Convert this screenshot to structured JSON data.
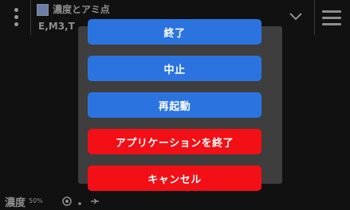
{
  "app": {
    "title": "濃度とアミ点",
    "subtitle": "E,M3,T"
  },
  "status_bar": {
    "label": "濃度",
    "percent": "50%"
  },
  "dialog": {
    "buttons": [
      {
        "label": "終了",
        "color": "#2b74e0"
      },
      {
        "label": "中止",
        "color": "#2b74e0"
      },
      {
        "label": "再起動",
        "color": "#2b74e0"
      },
      {
        "label": "アプリケーションを終了",
        "color": "#f20f15"
      },
      {
        "label": "キャンセル",
        "color": "#f20f15"
      }
    ]
  },
  "icons": {
    "menu": "kebab-menu-icon",
    "title": "app-logo-icon",
    "expand": "chevron-down-icon",
    "main_menu": "hamburger-menu-icon"
  }
}
